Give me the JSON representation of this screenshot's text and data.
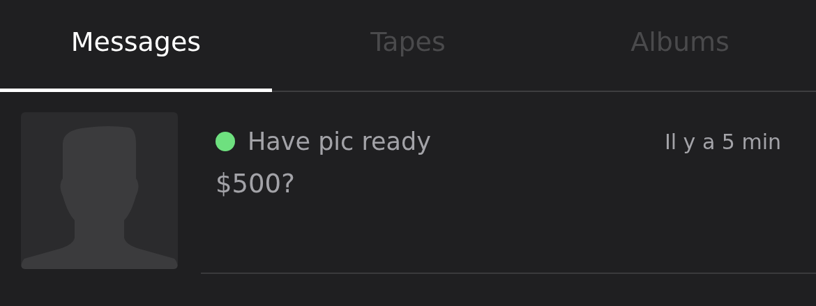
{
  "tabs": [
    {
      "label": "Messages",
      "selected": true
    },
    {
      "label": "Tapes",
      "selected": false
    },
    {
      "label": "Albums",
      "selected": false
    }
  ],
  "messages": [
    {
      "title": "Have pic ready",
      "preview": "$500?",
      "time": "Il y a 5 min",
      "online": true
    }
  ]
}
